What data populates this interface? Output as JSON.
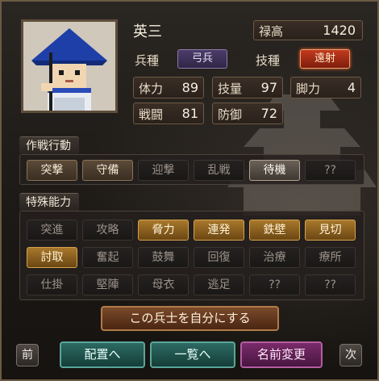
{
  "unit": {
    "name": "英三",
    "type_label": "兵種",
    "type_value": "弓兵",
    "skill_label": "技種",
    "skill_value": "遠射",
    "stipend_label": "禄高",
    "stipend_value": "1420"
  },
  "stats": [
    {
      "label": "体力",
      "value": "89"
    },
    {
      "label": "技量",
      "value": "97"
    },
    {
      "label": "脚力",
      "value": "4"
    },
    {
      "label": "戦闘",
      "value": "81"
    },
    {
      "label": "防御",
      "value": "72"
    }
  ],
  "tactics": {
    "title": "作戦行動",
    "items": [
      "突撃",
      "守備",
      "迎撃",
      "乱戦",
      "待機",
      "??"
    ]
  },
  "abilities": {
    "title": "特殊能力",
    "row1": [
      "突進",
      "攻略",
      "脅力",
      "連発",
      "鉄壁",
      "見切"
    ],
    "row2": [
      "討取",
      "奮起",
      "鼓舞",
      "回復",
      "治療",
      "療所"
    ],
    "row3": [
      "仕掛",
      "堅陣",
      "母衣",
      "逃足",
      "??",
      "??"
    ]
  },
  "buttons": {
    "make_own": "この兵士を自分にする",
    "prev": "前",
    "next": "次",
    "deploy": "配置へ",
    "list": "一覧へ",
    "rename": "名前変更"
  },
  "colors": {
    "active_gold": "#a8782b",
    "skill_red": "#c23b1f",
    "type_purple": "#4b3d6a"
  }
}
